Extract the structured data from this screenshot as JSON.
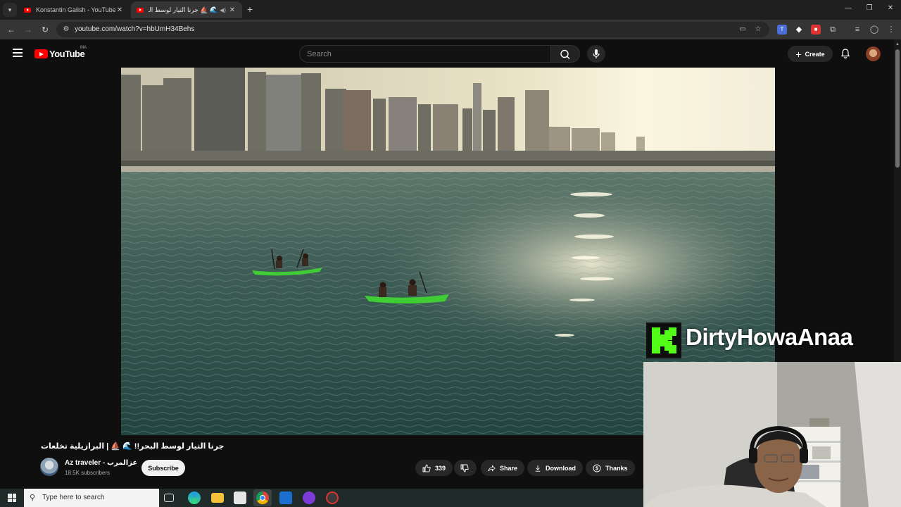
{
  "browser": {
    "tabs": [
      {
        "title": "Konstantin Galish - YouTube",
        "active": false
      },
      {
        "title": "🌊 ⛵ جرنا التيار لوسط البحر!!",
        "active": true
      }
    ],
    "url": "youtube.com/watch?v=hbUmH34Behs"
  },
  "youtube": {
    "logo_text": "YouTube",
    "region": "MA",
    "search_placeholder": "Search",
    "create_label": "Create"
  },
  "video": {
    "title": "جرنا التيار لوسط البحر!! 🌊 ⛵ | البرازيلية تخلعات",
    "channel": {
      "name": "Az traveler - عزالمرب",
      "subscribers": "18.5K subscribers"
    },
    "subscribe_label": "Subscribe",
    "likes": "339",
    "share_label": "Share",
    "download_label": "Download",
    "thanks_label": "Thanks"
  },
  "overlay": {
    "streamer_name": "DirtyHowaAnaa",
    "kick_logo_letter": "K",
    "kick_color": "#53fc18"
  },
  "taskbar": {
    "search_placeholder": "Type here to search"
  },
  "colors": {
    "youtube_red": "#ff0000",
    "page_bg": "#0f0f0f"
  }
}
